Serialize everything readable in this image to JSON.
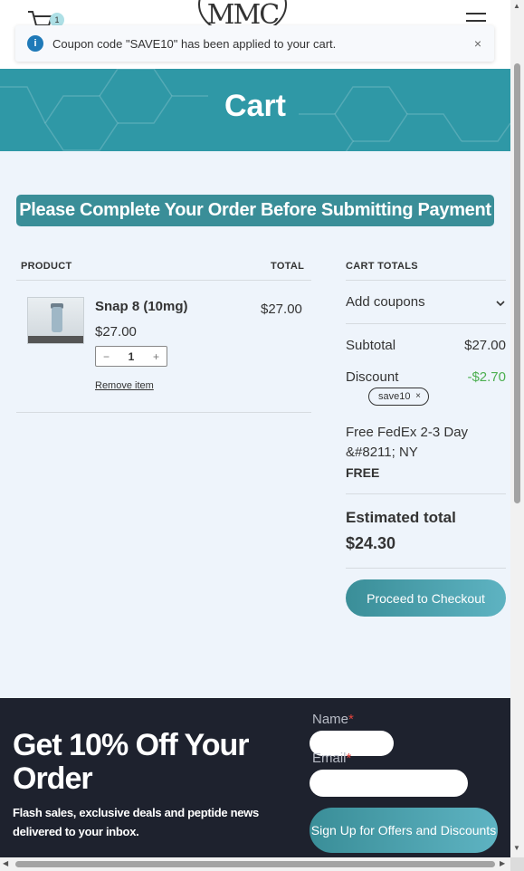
{
  "header": {
    "cart_count": "1",
    "logo_text": "MMC"
  },
  "notice": {
    "message": "Coupon code \"SAVE10\" has been applied to your cart.",
    "close": "×"
  },
  "hero": {
    "title": "Cart"
  },
  "banner": {
    "text": "Please Complete Your Order Before Submitting Payment"
  },
  "table": {
    "headers": {
      "product": "PRODUCT",
      "total": "TOTAL"
    },
    "items": [
      {
        "name": "Snap 8 (10mg)",
        "price": "$27.00",
        "quantity": "1",
        "line_total": "$27.00",
        "remove_label": "Remove item"
      }
    ],
    "qty_minus": "−",
    "qty_plus": "+"
  },
  "totals": {
    "heading": "CART TOTALS",
    "add_coupons": "Add coupons",
    "subtotal_label": "Subtotal",
    "subtotal_value": "$27.00",
    "discount_label": "Discount",
    "discount_value": "-$2.70",
    "coupon_code": "save10",
    "coupon_remove": "×",
    "shipping_method": "Free FedEx 2-3 Day &#8211; NY",
    "shipping_cost": "FREE",
    "estimated_label": "Estimated total",
    "estimated_value": "$24.30",
    "checkout_button": "Proceed to Checkout"
  },
  "footer": {
    "heading": "Get 10% Off Your Order",
    "subtext": "Flash sales, exclusive deals and peptide news delivered to your inbox.",
    "name_label": "Name",
    "email_label": "Email",
    "required_mark": "*",
    "signup_button": "Sign Up for Offers and Discounts"
  },
  "colors": {
    "hero": "#2f98a6",
    "banner": "#3a8e98",
    "discount": "#4caf50",
    "footer": "#1e222e",
    "info_icon": "#1f7ab8"
  }
}
